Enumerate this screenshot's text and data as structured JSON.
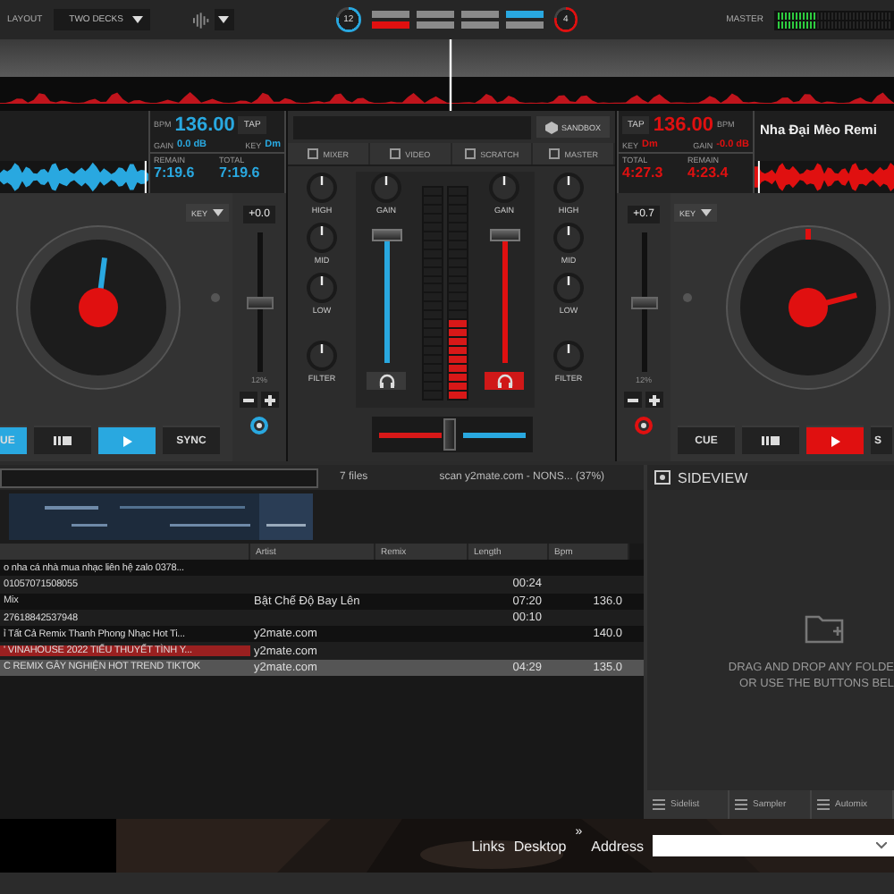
{
  "top_bar": {
    "layout_label": "LAYOUT",
    "layout_value": "TWO DECKS",
    "left_dial": "12",
    "right_dial": "4",
    "pads": [
      {
        "color": "#8a8a8a"
      },
      {
        "color": "#8a8a8a"
      },
      {
        "color": "#8a8a8a"
      },
      {
        "color": "#29a8e0"
      },
      {
        "color": "#e01010"
      },
      {
        "color": "#8a8a8a"
      },
      {
        "color": "#8a8a8a"
      },
      {
        "color": "#8a8a8a"
      }
    ],
    "master_label": "MASTER",
    "master_meter": [
      {
        "level": 0.34
      },
      {
        "level": 0.34
      }
    ]
  },
  "decks": [
    {
      "kind": "left",
      "color": "#29a8e0",
      "bpm_label": "BPM",
      "bpm": "136.00",
      "tap": "TAP",
      "gain_label": "GAIN",
      "gain": "0.0 dB",
      "key_label": "KEY",
      "key": "Dm",
      "remain_label": "REMAIN",
      "remain": "7:19.6",
      "total_label": "TOTAL",
      "total": "7:19.6",
      "key_button": "KEY",
      "pitch": "+0.0",
      "pitch_range": "12%",
      "pitch_slider": {
        "level": 0.5
      },
      "buttons": [
        {
          "kind": "cue",
          "label": "UE",
          "on": true
        },
        {
          "kind": "pause",
          "on": false
        },
        {
          "kind": "play",
          "on": true
        },
        {
          "kind": "sync",
          "label": "SYNC",
          "on": false
        }
      ]
    },
    {
      "kind": "right",
      "color": "#e01010",
      "title": "Nha Đại Mèo Remi",
      "bpm_label": "BPM",
      "bpm": "136.00",
      "tap": "TAP",
      "gain_label": "GAIN",
      "gain": "-0.0 dB",
      "key_label": "KEY",
      "key": "Dm",
      "remain_label": "REMAIN",
      "remain": "4:23.4",
      "total_label": "TOTAL",
      "total": "4:27.3",
      "key_button": "KEY",
      "pitch": "+0.7",
      "pitch_range": "12%",
      "pitch_slider": {
        "level": 0.5
      },
      "buttons": [
        {
          "kind": "cue",
          "label": "CUE",
          "on": false
        },
        {
          "kind": "pause",
          "on": false
        },
        {
          "kind": "play",
          "on": true
        },
        {
          "kind": "sync",
          "label": "S",
          "on": false
        }
      ]
    }
  ],
  "mixer": {
    "sandbox": "SANDBOX",
    "tabs": [
      "MIXER",
      "VIDEO",
      "SCRATCH",
      "MASTER"
    ],
    "channels": [
      {
        "eq": [
          "HIGH",
          "MID",
          "LOW",
          "FILTER"
        ],
        "gain": "GAIN",
        "fader": {
          "level": 0.95
        },
        "headphone_on": false,
        "vu": {
          "level": 0
        },
        "color": "#29a8e0"
      },
      {
        "eq": [
          "HIGH",
          "MID",
          "LOW",
          "FILTER"
        ],
        "gain": "GAIN",
        "fader": {
          "level": 0.95
        },
        "headphone_on": true,
        "vu": {
          "level": 0.36
        },
        "color": "#e01010"
      }
    ],
    "crossfader": {
      "level": 0.45
    }
  },
  "browser": {
    "file_count": "7 files",
    "scan_status": "scan y2mate.com -  NONS... (37%)",
    "columns": [
      "Artist",
      "Remix",
      "Length",
      "Bpm"
    ],
    "rows": [
      {
        "title": "o nha cá nhà mua nhạc liên hệ zalo 0378...",
        "selected": false,
        "marked": false
      },
      {
        "title": "01057071508055",
        "length": "00:24",
        "selected": false,
        "marked": false
      },
      {
        "title": "Mix",
        "artist": "Bật Chế Độ Bay Lên",
        "length": "07:20",
        "bpm": "136.0",
        "selected": false,
        "marked": false
      },
      {
        "title": "27618842537948",
        "length": "00:10",
        "selected": false,
        "marked": false
      },
      {
        "title": "ỉ Tất Cả Remix Thanh Phong Nhạc Hot Ti...",
        "artist": "y2mate.com",
        "bpm": "140.0",
        "selected": false,
        "marked": false
      },
      {
        "title": "' VINAHOUSE 2022  TIỂU THUYẾT TÌNH Y...",
        "artist": "y2mate.com",
        "selected": false,
        "marked": true
      },
      {
        "title": "C REMIX GÂY NGHIỆN HOT TREND TIKTOK",
        "artist": "y2mate.com",
        "length": "04:29",
        "bpm": "135.0",
        "selected": true,
        "marked": false
      }
    ]
  },
  "sideview": {
    "title": "SIDEVIEW",
    "hint": [
      "DRAG AND DROP ANY FOLDE",
      "OR USE THE BUTTONS BEL"
    ],
    "buttons": [
      "Sidelist",
      "Sampler",
      "Automix"
    ]
  },
  "taskbar": {
    "links": "Links",
    "desktop": "Desktop",
    "chevron": "»",
    "address_label": "Address"
  }
}
